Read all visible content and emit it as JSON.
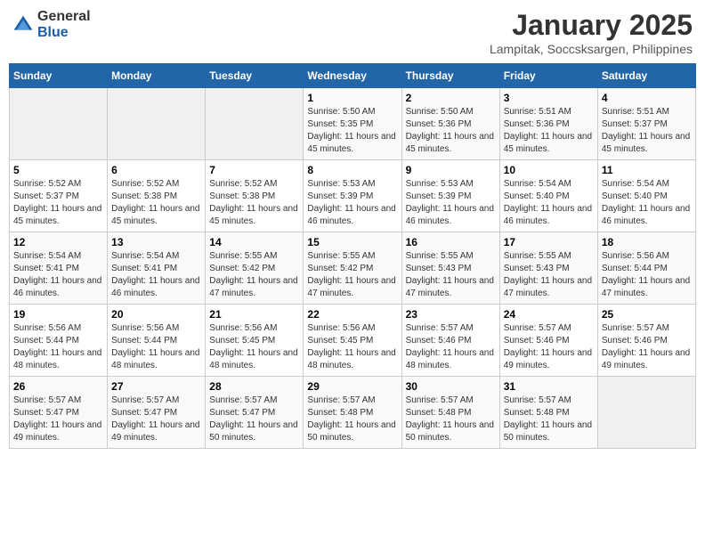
{
  "logo": {
    "general": "General",
    "blue": "Blue"
  },
  "header": {
    "title": "January 2025",
    "subtitle": "Lampitak, Soccsksargen, Philippines"
  },
  "days_of_week": [
    "Sunday",
    "Monday",
    "Tuesday",
    "Wednesday",
    "Thursday",
    "Friday",
    "Saturday"
  ],
  "weeks": [
    [
      {
        "day": "",
        "sunrise": "",
        "sunset": "",
        "daylight": ""
      },
      {
        "day": "",
        "sunrise": "",
        "sunset": "",
        "daylight": ""
      },
      {
        "day": "",
        "sunrise": "",
        "sunset": "",
        "daylight": ""
      },
      {
        "day": "1",
        "sunrise": "Sunrise: 5:50 AM",
        "sunset": "Sunset: 5:35 PM",
        "daylight": "Daylight: 11 hours and 45 minutes."
      },
      {
        "day": "2",
        "sunrise": "Sunrise: 5:50 AM",
        "sunset": "Sunset: 5:36 PM",
        "daylight": "Daylight: 11 hours and 45 minutes."
      },
      {
        "day": "3",
        "sunrise": "Sunrise: 5:51 AM",
        "sunset": "Sunset: 5:36 PM",
        "daylight": "Daylight: 11 hours and 45 minutes."
      },
      {
        "day": "4",
        "sunrise": "Sunrise: 5:51 AM",
        "sunset": "Sunset: 5:37 PM",
        "daylight": "Daylight: 11 hours and 45 minutes."
      }
    ],
    [
      {
        "day": "5",
        "sunrise": "Sunrise: 5:52 AM",
        "sunset": "Sunset: 5:37 PM",
        "daylight": "Daylight: 11 hours and 45 minutes."
      },
      {
        "day": "6",
        "sunrise": "Sunrise: 5:52 AM",
        "sunset": "Sunset: 5:38 PM",
        "daylight": "Daylight: 11 hours and 45 minutes."
      },
      {
        "day": "7",
        "sunrise": "Sunrise: 5:52 AM",
        "sunset": "Sunset: 5:38 PM",
        "daylight": "Daylight: 11 hours and 45 minutes."
      },
      {
        "day": "8",
        "sunrise": "Sunrise: 5:53 AM",
        "sunset": "Sunset: 5:39 PM",
        "daylight": "Daylight: 11 hours and 46 minutes."
      },
      {
        "day": "9",
        "sunrise": "Sunrise: 5:53 AM",
        "sunset": "Sunset: 5:39 PM",
        "daylight": "Daylight: 11 hours and 46 minutes."
      },
      {
        "day": "10",
        "sunrise": "Sunrise: 5:54 AM",
        "sunset": "Sunset: 5:40 PM",
        "daylight": "Daylight: 11 hours and 46 minutes."
      },
      {
        "day": "11",
        "sunrise": "Sunrise: 5:54 AM",
        "sunset": "Sunset: 5:40 PM",
        "daylight": "Daylight: 11 hours and 46 minutes."
      }
    ],
    [
      {
        "day": "12",
        "sunrise": "Sunrise: 5:54 AM",
        "sunset": "Sunset: 5:41 PM",
        "daylight": "Daylight: 11 hours and 46 minutes."
      },
      {
        "day": "13",
        "sunrise": "Sunrise: 5:54 AM",
        "sunset": "Sunset: 5:41 PM",
        "daylight": "Daylight: 11 hours and 46 minutes."
      },
      {
        "day": "14",
        "sunrise": "Sunrise: 5:55 AM",
        "sunset": "Sunset: 5:42 PM",
        "daylight": "Daylight: 11 hours and 47 minutes."
      },
      {
        "day": "15",
        "sunrise": "Sunrise: 5:55 AM",
        "sunset": "Sunset: 5:42 PM",
        "daylight": "Daylight: 11 hours and 47 minutes."
      },
      {
        "day": "16",
        "sunrise": "Sunrise: 5:55 AM",
        "sunset": "Sunset: 5:43 PM",
        "daylight": "Daylight: 11 hours and 47 minutes."
      },
      {
        "day": "17",
        "sunrise": "Sunrise: 5:55 AM",
        "sunset": "Sunset: 5:43 PM",
        "daylight": "Daylight: 11 hours and 47 minutes."
      },
      {
        "day": "18",
        "sunrise": "Sunrise: 5:56 AM",
        "sunset": "Sunset: 5:44 PM",
        "daylight": "Daylight: 11 hours and 47 minutes."
      }
    ],
    [
      {
        "day": "19",
        "sunrise": "Sunrise: 5:56 AM",
        "sunset": "Sunset: 5:44 PM",
        "daylight": "Daylight: 11 hours and 48 minutes."
      },
      {
        "day": "20",
        "sunrise": "Sunrise: 5:56 AM",
        "sunset": "Sunset: 5:44 PM",
        "daylight": "Daylight: 11 hours and 48 minutes."
      },
      {
        "day": "21",
        "sunrise": "Sunrise: 5:56 AM",
        "sunset": "Sunset: 5:45 PM",
        "daylight": "Daylight: 11 hours and 48 minutes."
      },
      {
        "day": "22",
        "sunrise": "Sunrise: 5:56 AM",
        "sunset": "Sunset: 5:45 PM",
        "daylight": "Daylight: 11 hours and 48 minutes."
      },
      {
        "day": "23",
        "sunrise": "Sunrise: 5:57 AM",
        "sunset": "Sunset: 5:46 PM",
        "daylight": "Daylight: 11 hours and 48 minutes."
      },
      {
        "day": "24",
        "sunrise": "Sunrise: 5:57 AM",
        "sunset": "Sunset: 5:46 PM",
        "daylight": "Daylight: 11 hours and 49 minutes."
      },
      {
        "day": "25",
        "sunrise": "Sunrise: 5:57 AM",
        "sunset": "Sunset: 5:46 PM",
        "daylight": "Daylight: 11 hours and 49 minutes."
      }
    ],
    [
      {
        "day": "26",
        "sunrise": "Sunrise: 5:57 AM",
        "sunset": "Sunset: 5:47 PM",
        "daylight": "Daylight: 11 hours and 49 minutes."
      },
      {
        "day": "27",
        "sunrise": "Sunrise: 5:57 AM",
        "sunset": "Sunset: 5:47 PM",
        "daylight": "Daylight: 11 hours and 49 minutes."
      },
      {
        "day": "28",
        "sunrise": "Sunrise: 5:57 AM",
        "sunset": "Sunset: 5:47 PM",
        "daylight": "Daylight: 11 hours and 50 minutes."
      },
      {
        "day": "29",
        "sunrise": "Sunrise: 5:57 AM",
        "sunset": "Sunset: 5:48 PM",
        "daylight": "Daylight: 11 hours and 50 minutes."
      },
      {
        "day": "30",
        "sunrise": "Sunrise: 5:57 AM",
        "sunset": "Sunset: 5:48 PM",
        "daylight": "Daylight: 11 hours and 50 minutes."
      },
      {
        "day": "31",
        "sunrise": "Sunrise: 5:57 AM",
        "sunset": "Sunset: 5:48 PM",
        "daylight": "Daylight: 11 hours and 50 minutes."
      },
      {
        "day": "",
        "sunrise": "",
        "sunset": "",
        "daylight": ""
      }
    ]
  ]
}
